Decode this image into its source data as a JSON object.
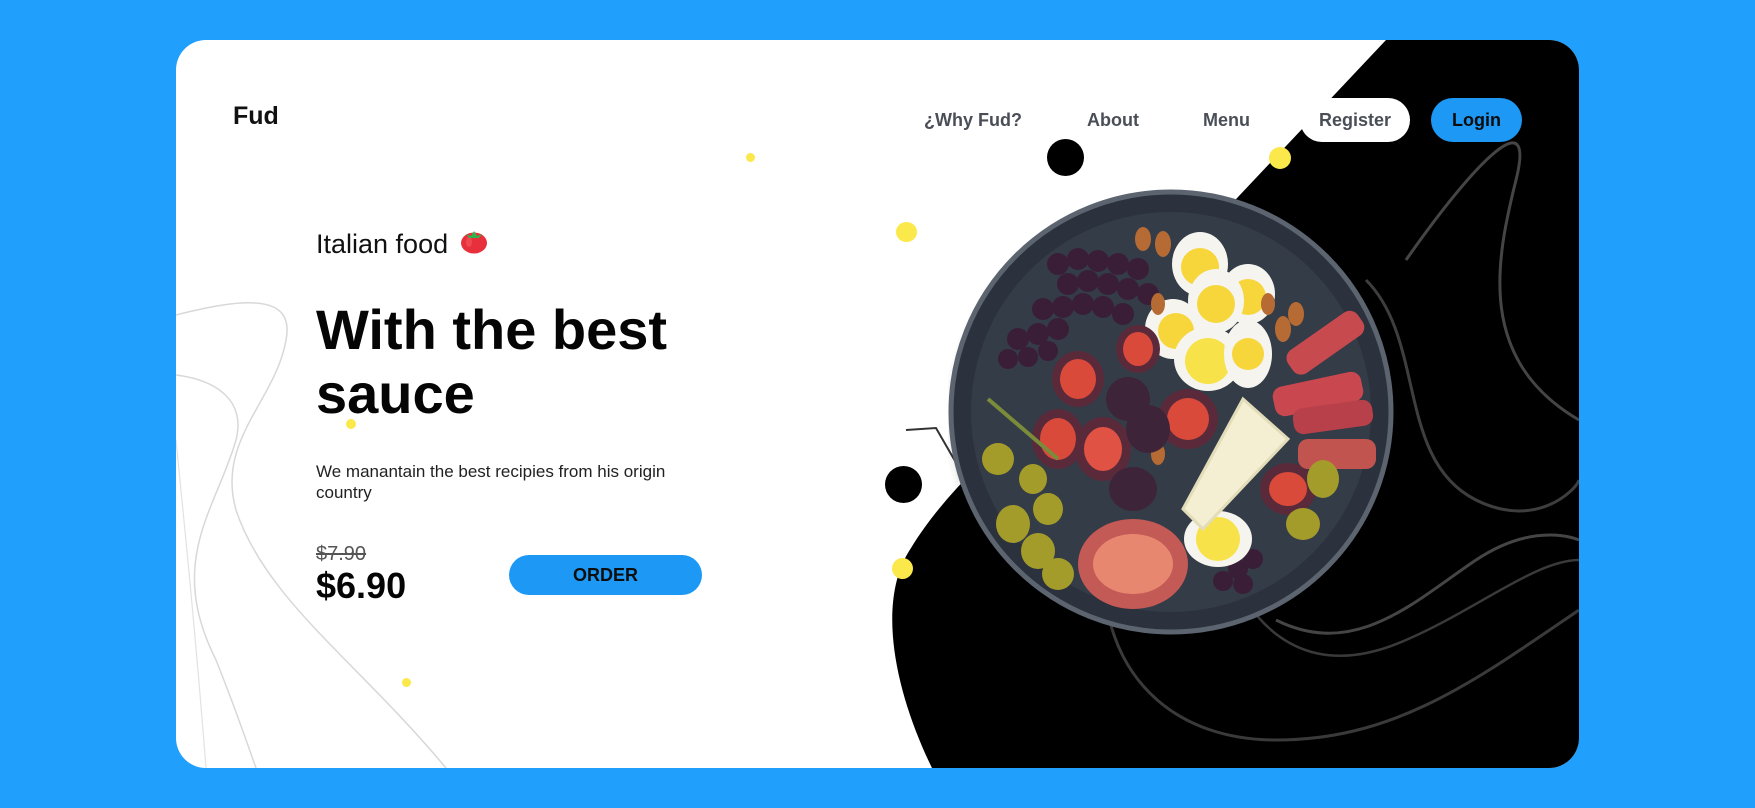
{
  "brand": {
    "logo_text": "Fud"
  },
  "nav": {
    "items": [
      {
        "label": "¿Why Fud?"
      },
      {
        "label": "About"
      },
      {
        "label": "Menu"
      }
    ],
    "register_label": "Register",
    "login_label": "Login"
  },
  "hero": {
    "eyebrow": "Italian food",
    "eyebrow_icon": "tomato-icon",
    "headline_line1": "With the best",
    "headline_line2": "sauce",
    "description": "We manantain the best recipies from his origin country",
    "old_price": "$7.90",
    "price": "$6.90",
    "order_label": "ORDER"
  },
  "colors": {
    "page_background": "#219ffc",
    "accent": "#1e98f5",
    "dark_shape": "#000000",
    "dot_yellow": "#fbe84a"
  },
  "images": {
    "hero_image": "food-platter-image"
  }
}
